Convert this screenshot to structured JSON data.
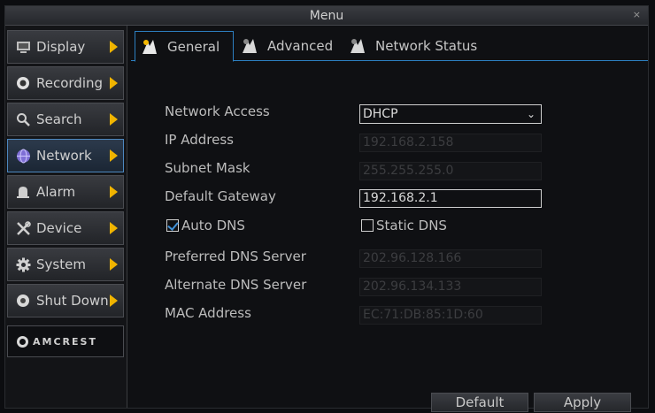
{
  "window": {
    "title": "Menu",
    "close": "×"
  },
  "sidebar": {
    "items": [
      {
        "label": "Display",
        "icon": "display-icon"
      },
      {
        "label": "Recording",
        "icon": "record-icon"
      },
      {
        "label": "Search",
        "icon": "search-icon"
      },
      {
        "label": "Network",
        "icon": "network-icon",
        "active": true
      },
      {
        "label": "Alarm",
        "icon": "alarm-icon"
      },
      {
        "label": "Device",
        "icon": "device-icon"
      },
      {
        "label": "System",
        "icon": "gear-icon"
      },
      {
        "label": "Shut Down",
        "icon": "power-icon"
      }
    ],
    "brand": "AMCREST"
  },
  "tabs": [
    {
      "label": "General",
      "active": true
    },
    {
      "label": "Advanced"
    },
    {
      "label": "Network Status"
    }
  ],
  "form": {
    "network_access": {
      "label": "Network Access",
      "value": "DHCP"
    },
    "ip_address": {
      "label": "IP Address",
      "value": "192.168.2.158"
    },
    "subnet_mask": {
      "label": "Subnet Mask",
      "value": "255.255.255.0"
    },
    "default_gateway": {
      "label": "Default Gateway",
      "value": "192.168.2.1"
    },
    "auto_dns": {
      "label": "Auto DNS",
      "checked": true
    },
    "static_dns": {
      "label": "Static DNS",
      "checked": false
    },
    "preferred_dns": {
      "label": "Preferred DNS Server",
      "value": "202.96.128.166"
    },
    "alternate_dns": {
      "label": "Alternate DNS Server",
      "value": "202.96.134.133"
    },
    "mac_address": {
      "label": "MAC Address",
      "value": "EC:71:DB:85:1D:60"
    }
  },
  "buttons": {
    "default": "Default",
    "apply": "Apply"
  },
  "colors": {
    "accent": "#2d7fc0",
    "arrow": "#f0b400"
  }
}
